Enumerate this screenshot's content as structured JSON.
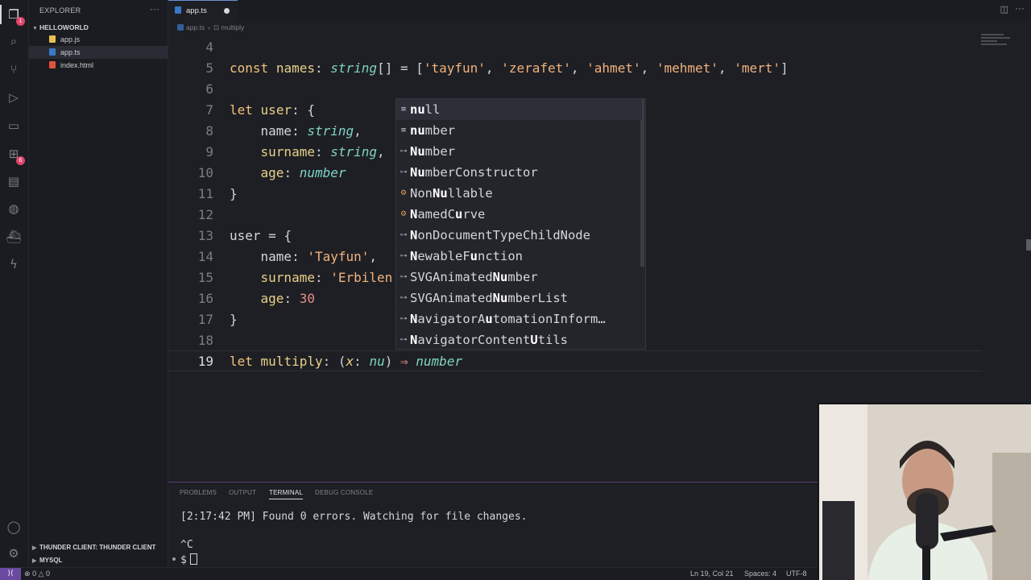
{
  "sidebar": {
    "title": "EXPLORER",
    "more": "···",
    "folder": "HELLOWORLD",
    "files": [
      {
        "name": "app.js",
        "icon": "js-file-icon",
        "color": "#e8c04a"
      },
      {
        "name": "app.ts",
        "icon": "ts-file-icon",
        "color": "#3a78c9"
      },
      {
        "name": "index.html",
        "icon": "html-file-icon",
        "color": "#e0533c"
      }
    ],
    "sections": [
      "THUNDER CLIENT: THUNDER CLIENT",
      "MYSQL"
    ]
  },
  "activity": {
    "explorer_badge": "1",
    "extensions_badge": "6"
  },
  "tabs": {
    "active": "app.ts",
    "more": "···"
  },
  "breadcrumb": {
    "file": "app.ts",
    "symbol": "multiply"
  },
  "editor": {
    "line_numbers": [
      "4",
      "5",
      "6",
      "7",
      "8",
      "9",
      "10",
      "11",
      "12",
      "13",
      "14",
      "15",
      "16",
      "17",
      "18",
      "19"
    ],
    "current_line": "19"
  },
  "suggest": {
    "items": [
      {
        "pre": "",
        "m": "nu",
        "post": "ll",
        "kind": "keyword"
      },
      {
        "pre": "",
        "m": "nu",
        "post": "mber",
        "kind": "keyword"
      },
      {
        "pre": "",
        "m": "Nu",
        "post": "mber",
        "kind": "interface"
      },
      {
        "pre": "",
        "m": "Nu",
        "post": "mberConstructor",
        "kind": "interface"
      },
      {
        "pre": "Non",
        "m": "Nu",
        "post": "llable",
        "kind": "class"
      },
      {
        "pre": "",
        "m": "N",
        "post": "amedC",
        "m2": "u",
        "post2": "rve",
        "kind": "class"
      },
      {
        "pre": "",
        "m": "N",
        "post": "onDocumentTypeChildNode",
        "kind": "interface"
      },
      {
        "pre": "",
        "m": "N",
        "post": "ewableF",
        "m2": "u",
        "post2": "nction",
        "kind": "interface"
      },
      {
        "pre": "SVGAnimated",
        "m": "Nu",
        "post": "mber",
        "kind": "interface"
      },
      {
        "pre": "SVGAnimated",
        "m": "Nu",
        "post": "mberList",
        "kind": "interface"
      },
      {
        "pre": "",
        "m": "N",
        "post": "avigatorA",
        "m2": "u",
        "post2": "tomationInform…",
        "kind": "interface"
      },
      {
        "pre": "",
        "m": "N",
        "post": "avigatorContent",
        "m2": "U",
        "post2": "tils",
        "kind": "interface"
      }
    ]
  },
  "panel": {
    "tabs": [
      "PROBLEMS",
      "OUTPUT",
      "TERMINAL",
      "DEBUG CONSOLE"
    ],
    "active_tab": "TERMINAL",
    "terminal_lines": [
      "[2:17:42 PM] Found 0 errors. Watching for file changes.",
      "^C",
      "$"
    ]
  },
  "statusbar": {
    "remote": "⟩⟨",
    "errors": "0",
    "warnings": "0",
    "position": "Ln 19, Col 21",
    "spaces": "Spaces: 4",
    "encoding": "UTF-8"
  },
  "colors": {
    "keyword": "#f0c27b",
    "type": "#7fd4c4",
    "string": "#f1b27d",
    "number": "#e58f87",
    "accent": "#6a4aa0"
  }
}
